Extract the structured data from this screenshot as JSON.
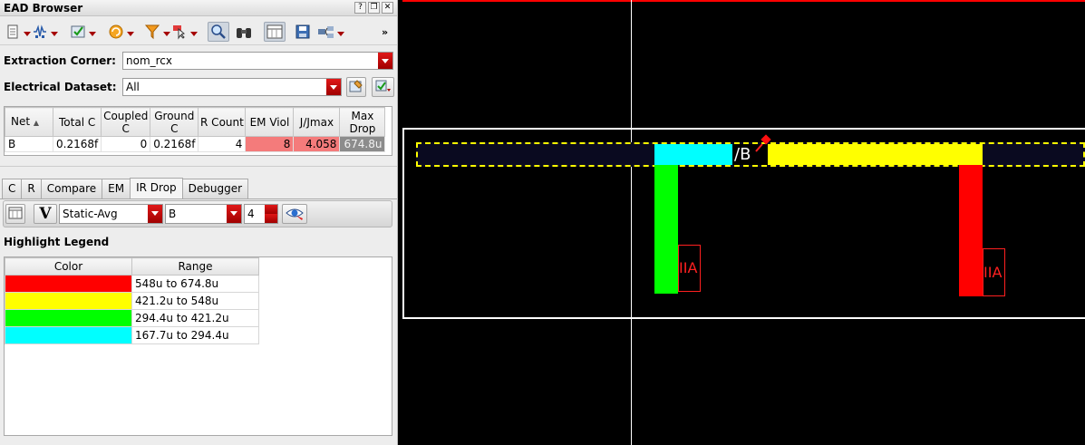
{
  "window": {
    "title": "EAD Browser"
  },
  "form": {
    "extraction_corner_label": "Extraction Corner:",
    "extraction_corner_value": "nom_rcx",
    "electrical_dataset_label": "Electrical Dataset:",
    "electrical_dataset_value": "All"
  },
  "net_table": {
    "headers": [
      "Net",
      "Total C",
      "Coupled C",
      "Ground C",
      "R Count",
      "EM Viol",
      "J/Jmax",
      "Max Drop"
    ],
    "rows": [
      {
        "net": "B",
        "total_c": "0.2168f",
        "coupled_c": "0",
        "ground_c": "0.2168f",
        "r_count": "4",
        "em_viol": "8",
        "j_jmax": "4.058",
        "max_drop": "674.8u"
      }
    ]
  },
  "tabs": [
    {
      "label": "C"
    },
    {
      "label": "R"
    },
    {
      "label": "Compare"
    },
    {
      "label": "EM"
    },
    {
      "label": "IR Drop",
      "active": true
    },
    {
      "label": "Debugger"
    }
  ],
  "ir_toolbar": {
    "v_label": "V",
    "mode_value": "Static-Avg",
    "net_value": "B",
    "bins_value": "4"
  },
  "legend": {
    "title": "Highlight Legend",
    "headers": [
      "Color",
      "Range"
    ],
    "rows": [
      {
        "color": "#ff0000",
        "range": "548u to 674.8u"
      },
      {
        "color": "#ffff00",
        "range": "421.2u to 548u"
      },
      {
        "color": "#00ff00",
        "range": "294.4u to 421.2u"
      },
      {
        "color": "#00ffff",
        "range": "167.7u to 294.4u"
      }
    ]
  },
  "layout": {
    "net_label": "/B",
    "pin_label_left": "IIA",
    "pin_label_right": "IIA",
    "colors": {
      "background": "#000000",
      "selection": "#ffff00",
      "guide": "#ffffff",
      "top_border": "#ff0000"
    }
  },
  "icons": [
    "document-icon",
    "circuit-icon",
    "check-icon",
    "refresh-icon",
    "filter-icon",
    "probe-icon",
    "zoom-icon",
    "binoculars-icon",
    "table-icon",
    "save-icon",
    "network-icon",
    "overflow-icon",
    "dataset-edit-icon",
    "dataset-check-icon",
    "table-view-icon",
    "visibility-icon",
    "pin-marker-icon"
  ]
}
